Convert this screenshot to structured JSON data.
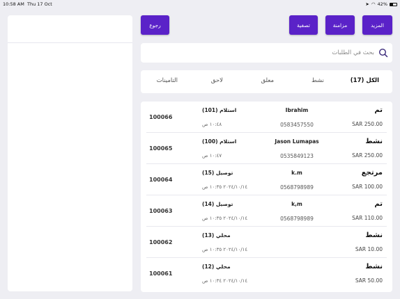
{
  "status_bar": {
    "time": "10:58 AM",
    "date": "Thu 17 Oct",
    "battery": "42%",
    "battery_level": 0.42
  },
  "buttons": {
    "back": "رجوع",
    "filter": "تصفية",
    "sync": "مزامنة",
    "more": "المزيد"
  },
  "search": {
    "placeholder": "بحث في الطلبات"
  },
  "tabs": [
    {
      "label": "الكل (17)"
    },
    {
      "label": "نشط"
    },
    {
      "label": "معلق"
    },
    {
      "label": "لاحق"
    },
    {
      "label": "التامينات"
    }
  ],
  "orders": [
    {
      "status": "تم",
      "amount": "SAR 250.00",
      "name": "Ibrahim",
      "phone": "0583457550",
      "type": "استلام (101)",
      "time": "١٠:٤٨ ص",
      "id": "100066"
    },
    {
      "status": "نشط",
      "amount": "SAR 250.00",
      "name": "Jason Lumapas",
      "phone": "0535849123",
      "type": "استلام (100)",
      "time": "١٠:٤٧ ص",
      "id": "100065"
    },
    {
      "status": "مرتجع",
      "amount": "SAR 100.00",
      "name": "k.m",
      "phone": "0568798989",
      "type": "توصيل (15)",
      "time": "٢٠٢٤/١٠/١٤ ١٠:٣٥ ص",
      "id": "100064"
    },
    {
      "status": "تم",
      "amount": "SAR 110.00",
      "name": "k,m",
      "phone": "0568798989",
      "type": "توصيل (14)",
      "time": "٢٠٢٤/١٠/١٤ ١٠:٣٥ ص",
      "id": "100063"
    },
    {
      "status": "نشط",
      "amount": "SAR 10.00",
      "name": "",
      "phone": "",
      "type": "محلي (13)",
      "time": "٢٠٢٤/١٠/١٤ ١٠:٣٥ ص",
      "id": "100062"
    },
    {
      "status": "نشط",
      "amount": "SAR 50.00",
      "name": "",
      "phone": "",
      "type": "محلي (12)",
      "time": "٢٠٢٤/١٠/١٤ ١٠:٣٤ ص",
      "id": "100061"
    }
  ],
  "colors": {
    "accent": "#5a22c8",
    "background": "#eeeef3"
  }
}
